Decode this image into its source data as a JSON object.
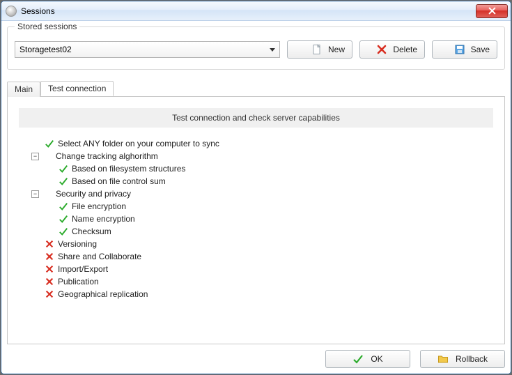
{
  "window": {
    "title": "Sessions"
  },
  "stored": {
    "group_label": "Stored sessions",
    "selected": "Storagetest02",
    "buttons": {
      "new": "New",
      "delete": "Delete",
      "save": "Save"
    }
  },
  "tabs": {
    "main": "Main",
    "test_connection": "Test connection",
    "active": "test_connection"
  },
  "panel": {
    "header": "Test connection and check server capabilities",
    "tree": {
      "select_any": "Select ANY folder on your computer to sync",
      "change_tracking": "Change tracking alghorithm",
      "based_fs": "Based on filesystem structures",
      "based_sum": "Based on file control sum",
      "security": "Security and privacy",
      "file_enc": "File encryption",
      "name_enc": "Name encryption",
      "checksum": "Checksum",
      "versioning": "Versioning",
      "share": "Share and Collaborate",
      "import_export": "Import/Export",
      "publication": "Publication",
      "geo": "Geographical replication"
    }
  },
  "footer": {
    "ok": "OK",
    "rollback": "Rollback"
  }
}
